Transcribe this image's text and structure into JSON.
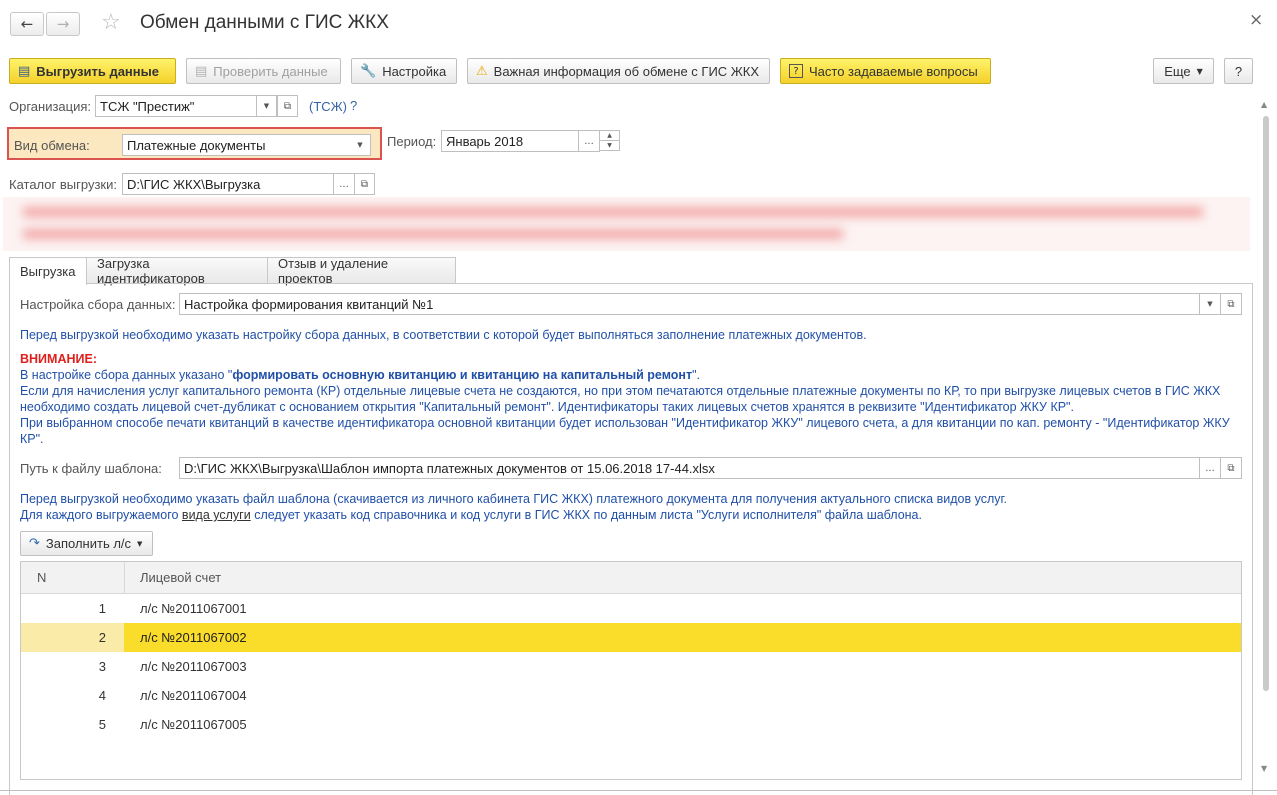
{
  "window": {
    "title": "Обмен данными с ГИС ЖКХ",
    "close_icon": "×"
  },
  "toolbar": {
    "upload_label": "Выгрузить данные",
    "check_label": "Проверить данные",
    "settings_label": "Настройка",
    "important_label": "Важная информация об обмене с ГИС ЖКХ",
    "faq_label": "Часто задаваемые вопросы",
    "more_label": "Еще",
    "help_label": "?"
  },
  "form": {
    "org_label": "Организация:",
    "org_value": "ТСЖ \"Престиж\"",
    "org_type_link": "(ТСЖ)",
    "org_help": "?",
    "exchange_label": "Вид обмена:",
    "exchange_value": "Платежные документы",
    "period_label": "Период:",
    "period_value": "Январь 2018",
    "catalog_label": "Каталог выгрузки:",
    "catalog_value": "D:\\ГИС ЖКХ\\Выгрузка"
  },
  "tabs": [
    {
      "label": "Выгрузка"
    },
    {
      "label": "Загрузка идентификаторов"
    },
    {
      "label": "Отзыв и удаление проектов"
    }
  ],
  "upload": {
    "collect_label": "Настройка сбора данных:",
    "collect_value": "Настройка формирования квитанций №1",
    "collect_hint": "Перед выгрузкой необходимо указать настройку сбора данных, в соответствии с которой будет выполняться заполнение платежных документов.",
    "warning_title": "ВНИМАНИЕ:",
    "warning_line1_pre": "В настройке сбора данных указано \"",
    "warning_line1_bold": "формировать основную квитанцию и квитанцию на капитальный ремонт",
    "warning_line1_post": "\".",
    "warning_line2": "Если для начисления услуг капитального ремонта (КР) отдельные лицевые счета не создаются, но при этом печатаются отдельные платежные документы по КР, то при выгрузке лицевых счетов в ГИС ЖКХ необходимо создать лицевой счет-дубликат с основанием открытия \"Капитальный ремонт\". Идентификаторы таких лицевых счетов хранятся в реквизите \"Идентификатор ЖКУ КР\".",
    "warning_line3": "При выбранном способе печати квитанций в качестве идентификатора основной квитанции будет использован \"Идентификатор ЖКУ\" лицевого счета, а для квитанции по кап. ремонту - \"Идентификатор ЖКУ КР\".",
    "template_label": "Путь к файлу шаблона:",
    "template_value": "D:\\ГИС ЖКХ\\Выгрузка\\Шаблон импорта платежных документов от 15.06.2018 17-44.xlsx",
    "template_hint1": "Перед выгрузкой необходимо указать файл шаблона (скачивается из личного кабинета ГИС ЖКХ) платежного документа для получения актуального списка видов услуг.",
    "template_hint2_pre": "Для каждого выгружаемого ",
    "template_hint2_link": "вида услуги",
    "template_hint2_post": " следует указать код справочника и код услуги в ГИС ЖКХ по данным листа \"Услуги исполнителя\" файла шаблона.",
    "fill_button": "Заполнить л/с"
  },
  "table": {
    "columns": [
      "N",
      "Лицевой счет"
    ],
    "rows": [
      {
        "n": "1",
        "account": "л/с №2011067001"
      },
      {
        "n": "2",
        "account": "л/с №2011067002"
      },
      {
        "n": "3",
        "account": "л/с №2011067003"
      },
      {
        "n": "4",
        "account": "л/с №2011067004"
      },
      {
        "n": "5",
        "account": "л/с №2011067005"
      }
    ],
    "selected_row": 2
  },
  "colors": {
    "accent_yellow": "#f4d12a",
    "highlight_red": "#d9534f",
    "link_blue": "#2150a8",
    "warning_red": "#e0201c"
  }
}
